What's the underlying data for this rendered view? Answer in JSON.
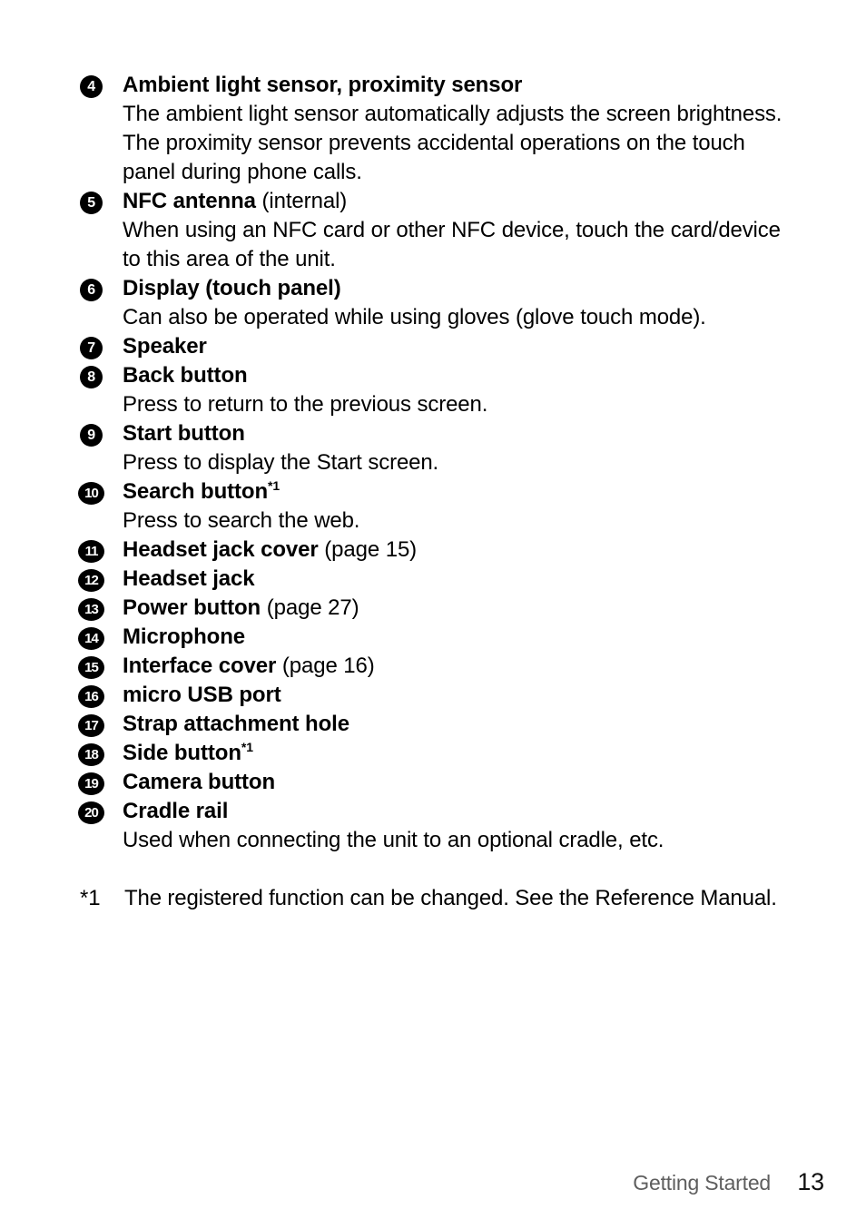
{
  "page": {
    "items": [
      {
        "number": "4",
        "title_bold": "Ambient light sensor, proximity sensor",
        "title_plain": "",
        "superscript": "",
        "desc": "The ambient light sensor automatically adjusts the screen brightness. The proximity sensor prevents accidental operations on the touch panel during phone calls."
      },
      {
        "number": "5",
        "title_bold": "NFC antenna",
        "title_plain": " (internal)",
        "superscript": "",
        "desc": "When using an NFC card or other NFC device, touch the card/device to this area of the unit."
      },
      {
        "number": "6",
        "title_bold": "Display (touch panel)",
        "title_plain": "",
        "superscript": "",
        "desc": "Can also be operated while using gloves (glove touch mode)."
      },
      {
        "number": "7",
        "title_bold": "Speaker",
        "title_plain": "",
        "superscript": "",
        "desc": ""
      },
      {
        "number": "8",
        "title_bold": "Back button",
        "title_plain": "",
        "superscript": "",
        "desc": "Press to return to the previous screen."
      },
      {
        "number": "9",
        "title_bold": "Start button",
        "title_plain": "",
        "superscript": "",
        "desc": "Press to display the Start screen."
      },
      {
        "number": "10",
        "title_bold": "Search button",
        "title_plain": "",
        "superscript": "*1",
        "desc": "Press to search the web."
      },
      {
        "number": "11",
        "title_bold": "Headset jack cover",
        "title_plain": " (page 15)",
        "superscript": "",
        "desc": ""
      },
      {
        "number": "12",
        "title_bold": "Headset jack",
        "title_plain": "",
        "superscript": "",
        "desc": ""
      },
      {
        "number": "13",
        "title_bold": "Power button",
        "title_plain": " (page 27)",
        "superscript": "",
        "desc": ""
      },
      {
        "number": "14",
        "title_bold": "Microphone",
        "title_plain": "",
        "superscript": "",
        "desc": ""
      },
      {
        "number": "15",
        "title_bold": "Interface cover",
        "title_plain": " (page 16)",
        "superscript": "",
        "desc": ""
      },
      {
        "number": "16",
        "title_bold": "micro USB port",
        "title_plain": "",
        "superscript": "",
        "desc": ""
      },
      {
        "number": "17",
        "title_bold": "Strap attachment hole",
        "title_plain": "",
        "superscript": "",
        "desc": ""
      },
      {
        "number": "18",
        "title_bold": "Side button",
        "title_plain": "",
        "superscript": "*1",
        "desc": ""
      },
      {
        "number": "19",
        "title_bold": "Camera button",
        "title_plain": "",
        "superscript": "",
        "desc": ""
      },
      {
        "number": "20",
        "title_bold": "Cradle rail",
        "title_plain": "",
        "superscript": "",
        "desc": "Used when connecting the unit to an optional cradle, etc."
      }
    ],
    "footnote": {
      "marker": "*1",
      "text": "The registered function can be changed. See the Reference Manual."
    },
    "footer": {
      "section": "Getting Started",
      "page_number": "13"
    }
  }
}
